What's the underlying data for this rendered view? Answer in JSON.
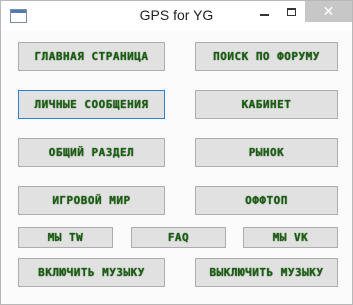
{
  "window": {
    "title": "GPS for YG",
    "close_symbol": "✕"
  },
  "buttons": {
    "home": "ГЛАВНАЯ СТРАНИЦА",
    "forum_search": "ПОИСК ПО ФОРУМУ",
    "private_messages": "ЛИЧНЫЕ СООБЩЕНИЯ",
    "cabinet": "КАБИНЕТ",
    "general_section": "ОБЩИЙ РАЗДЕЛ",
    "market": "РЫНОК",
    "game_world": "ИГРОВОЙ МИР",
    "offtopic": "ОФФТОП",
    "we_tw": "МЫ TW",
    "faq": "FAQ",
    "we_vk": "МЫ VK",
    "music_on": "ВКЛЮЧИТЬ МУЗЫКУ",
    "music_off": "ВЫКЛЮЧИТЬ МУЗЫКУ"
  },
  "accent_colors": {
    "button_text": "#1a5e12",
    "focus_border": "#2f7fd6",
    "close_button_bg": "#c7c7c7"
  },
  "focused_button": "private_messages"
}
